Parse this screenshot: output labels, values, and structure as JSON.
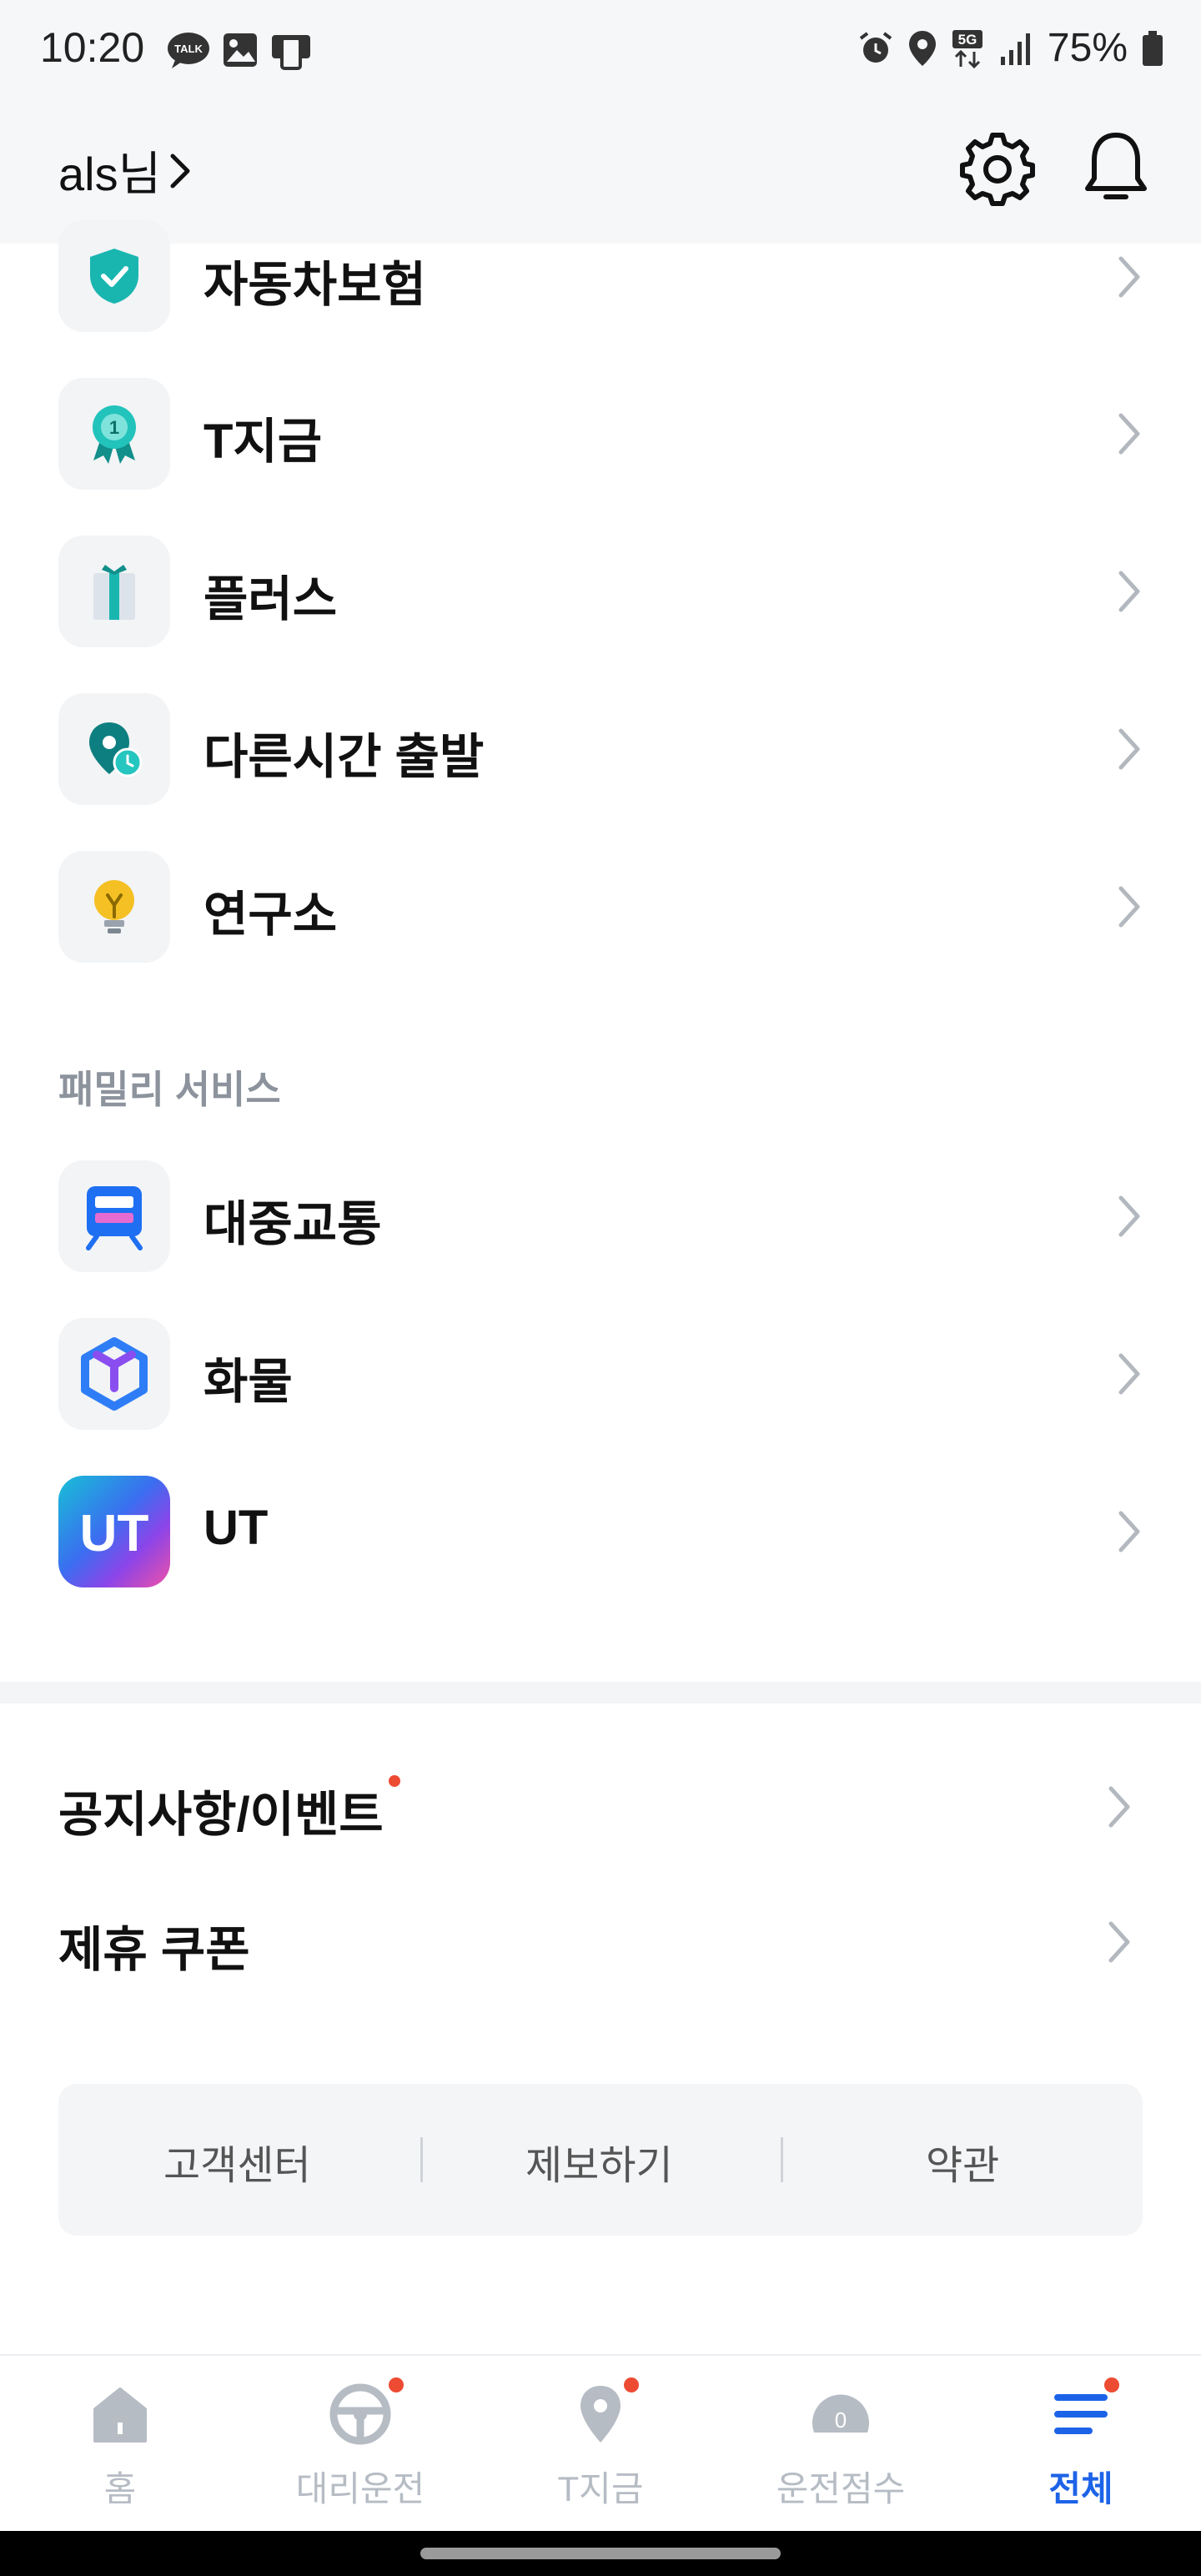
{
  "status_bar": {
    "time": "10:20",
    "battery": "75%",
    "icons_left": [
      "talk-icon",
      "gallery-icon",
      "device-icon"
    ],
    "icons_right": [
      "alarm-icon",
      "location-icon",
      "5g-icon",
      "signal-icon",
      "battery-icon"
    ]
  },
  "header": {
    "user": "als님",
    "settings_icon": "gear-icon",
    "notification_icon": "bell-icon"
  },
  "menu": [
    {
      "label": "자동차보험",
      "icon": "shield-check-icon"
    },
    {
      "label": "T지금",
      "icon": "badge-one-icon"
    },
    {
      "label": "플러스",
      "icon": "gift-icon"
    },
    {
      "label": "다른시간 출발",
      "icon": "pin-clock-icon"
    },
    {
      "label": "연구소",
      "icon": "lightbulb-icon"
    }
  ],
  "family_section": {
    "title": "패밀리 서비스",
    "items": [
      {
        "label": "대중교통",
        "icon": "train-icon"
      },
      {
        "label": "화물",
        "icon": "cube-icon"
      },
      {
        "label": "UT",
        "icon": "ut-logo-icon",
        "logo_text": "UT"
      }
    ]
  },
  "links": [
    {
      "label": "공지사항/이벤트",
      "badge": true
    },
    {
      "label": "제휴 쿠폰",
      "badge": false
    }
  ],
  "footer": {
    "links": [
      "고객센터",
      "제보하기",
      "약관"
    ]
  },
  "tabbar": {
    "tabs": [
      {
        "label": "홈",
        "icon": "home-icon",
        "badge": false,
        "active": false
      },
      {
        "label": "대리운전",
        "icon": "steering-wheel-icon",
        "badge": true,
        "active": false
      },
      {
        "label": "T지금",
        "icon": "pin-icon",
        "badge": true,
        "active": false
      },
      {
        "label": "운전점수",
        "icon": "gauge-icon",
        "badge": false,
        "active": false,
        "gauge_value": "0"
      },
      {
        "label": "전체",
        "icon": "menu-icon",
        "badge": true,
        "active": true
      }
    ]
  },
  "colors": {
    "accent": "#1d63e8",
    "badge": "#ee4b33",
    "teal": "#19b6b0",
    "section_gray": "#8c939c"
  }
}
